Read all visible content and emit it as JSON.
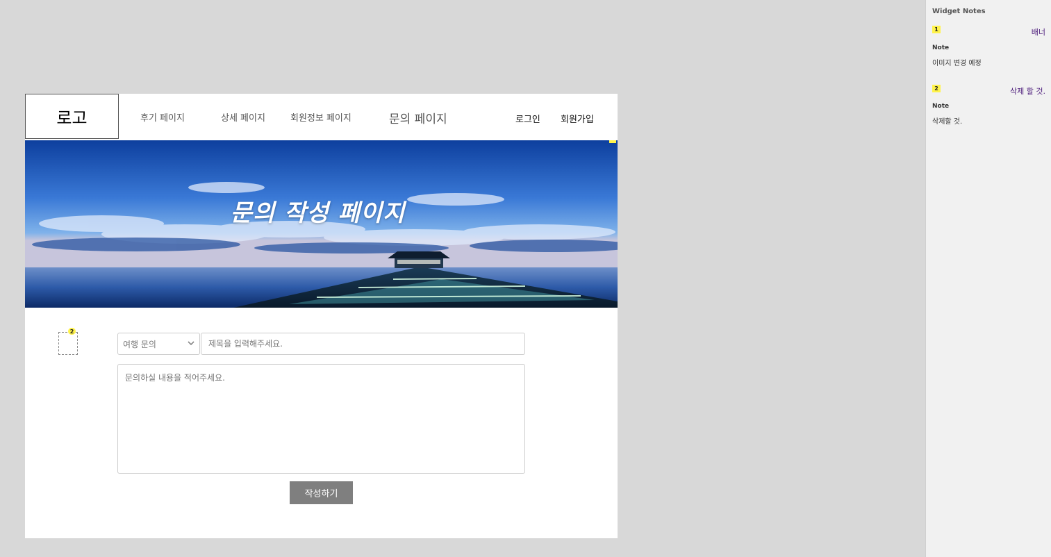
{
  "header": {
    "logo": "로고",
    "nav": [
      {
        "label": "후기 페이지"
      },
      {
        "label": "상세 페이지"
      },
      {
        "label": "회원정보 페이지"
      },
      {
        "label": "문의 페이지"
      }
    ],
    "login": "로그인",
    "signup": "회원가입"
  },
  "banner": {
    "title": "문의 작성 페이지",
    "marker": "1"
  },
  "form": {
    "marker": "2",
    "category_selected": "여행 문의",
    "title_placeholder": "제목을 입력해주세요.",
    "content_placeholder": "문의하실 내용을 적어주세요.",
    "submit_label": "작성하기"
  },
  "notes": {
    "header": "Widget Notes",
    "items": [
      {
        "badge": "1",
        "name": "배너",
        "label": "Note",
        "text": "이미지 변경 예정"
      },
      {
        "badge": "2",
        "name": "삭제 할 것.",
        "label": "Note",
        "text": "삭제할 것."
      }
    ]
  },
  "colors": {
    "canvas_bg": "#d8d8d8",
    "page_bg": "#ffffff",
    "button_bg": "#7f7f7f",
    "note_marker": "#fff34a",
    "note_name": "#4b1a7a"
  }
}
